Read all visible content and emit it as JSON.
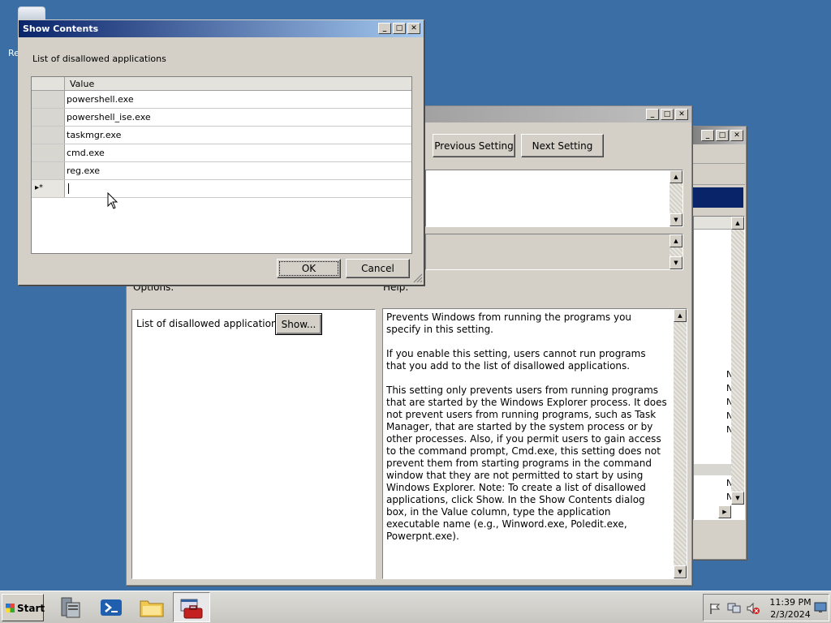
{
  "desktop": {
    "icon_label": "Re"
  },
  "show_contents": {
    "title": "Show Contents",
    "heading": "List of disallowed applications",
    "column_header": "Value",
    "rows": [
      "powershell.exe",
      "powershell_ise.exe",
      "taskmgr.exe",
      "cmd.exe",
      "reg.exe"
    ],
    "new_row_marker": "▸*",
    "ok_label": "OK",
    "cancel_label": "Cancel"
  },
  "policy_window": {
    "previous_label": "Previous Setting",
    "next_label": "Next Setting",
    "options_label": "Options:",
    "help_label": "Help:",
    "option_item": "List of disallowed applications",
    "show_button": "Show...",
    "help_paragraphs": [
      "Prevents Windows from running the programs you specify in this setting.",
      "If you enable this setting, users cannot run programs that you add to the list of disallowed applications.",
      "This setting only prevents users from running programs that are started by the Windows Explorer process. It does not prevent users from running programs, such as Task Manager, that are started by the system process or by other processes. Also, if you permit users to gain access to the command prompt, Cmd.exe, this setting does not prevent them from starting programs in the command window that they are not permitted to start by using Windows Explorer. Note: To create a list of disallowed applications, click Show. In the Show Contents dialog box, in the Value column, type the application executable name (e.g., Winword.exe, Poledit.exe, Powerpnt.exe)."
    ]
  },
  "back_window": {
    "partial_items": [
      "N",
      "N",
      "N",
      "N",
      "N",
      "N",
      "N"
    ]
  },
  "taskbar": {
    "start_label": "Start",
    "time": "11:39 PM",
    "date": "2/3/2024"
  },
  "window_buttons": {
    "minimize": "_",
    "maximize": "□",
    "close": "✕"
  }
}
